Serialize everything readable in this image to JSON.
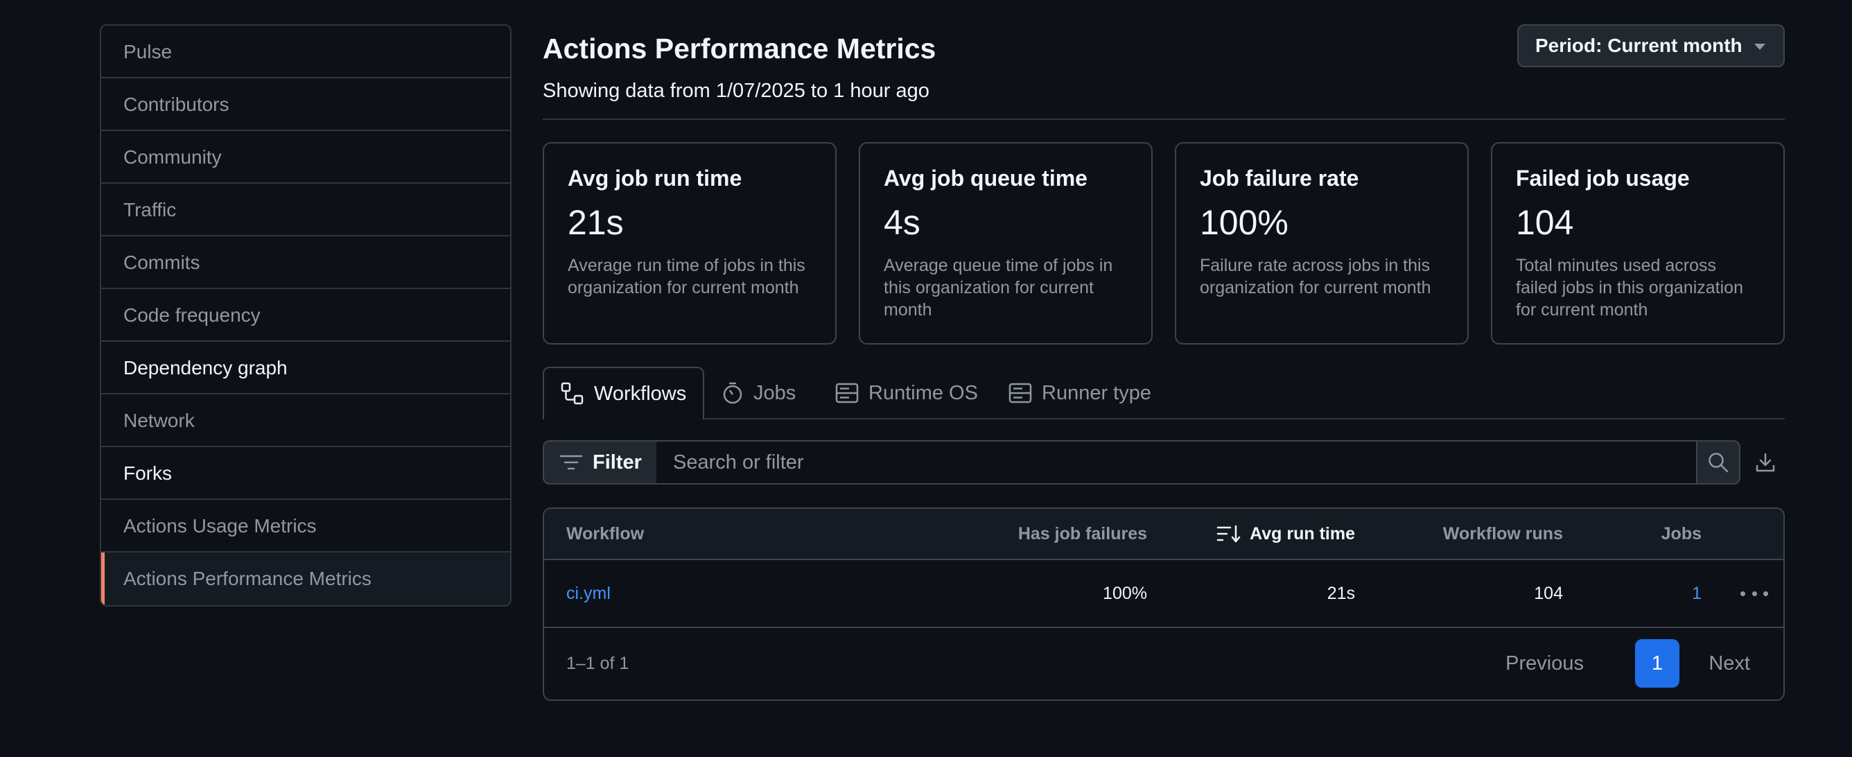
{
  "sidebar": {
    "items": [
      {
        "label": "Pulse"
      },
      {
        "label": "Contributors"
      },
      {
        "label": "Community"
      },
      {
        "label": "Traffic"
      },
      {
        "label": "Commits"
      },
      {
        "label": "Code frequency"
      },
      {
        "label": "Dependency graph"
      },
      {
        "label": "Network"
      },
      {
        "label": "Forks"
      },
      {
        "label": "Actions Usage Metrics"
      },
      {
        "label": "Actions Performance Metrics"
      }
    ]
  },
  "header": {
    "title": "Actions Performance Metrics",
    "subtitle": "Showing data from 1/07/2025 to 1 hour ago",
    "period_label": "Period: Current month"
  },
  "cards": [
    {
      "title": "Avg job run time",
      "value": "21s",
      "description": "Average run time of jobs in this organization for current month"
    },
    {
      "title": "Avg job queue time",
      "value": "4s",
      "description": "Average queue time of jobs in this organization for current month"
    },
    {
      "title": "Job failure rate",
      "value": "100%",
      "description": "Failure rate across jobs in this organization for current month"
    },
    {
      "title": "Failed job usage",
      "value": "104",
      "description": "Total minutes used across failed jobs in this organization for current month"
    }
  ],
  "tabs": [
    {
      "label": "Workflows",
      "icon": "workflow-icon"
    },
    {
      "label": "Jobs",
      "icon": "stopwatch-icon"
    },
    {
      "label": "Runtime OS",
      "icon": "server-icon"
    },
    {
      "label": "Runner type",
      "icon": "server-icon"
    }
  ],
  "filter": {
    "button_label": "Filter",
    "placeholder": "Search or filter"
  },
  "table": {
    "headers": {
      "workflow": "Workflow",
      "has_job_failures": "Has job failures",
      "avg_run_time": "Avg run time",
      "workflow_runs": "Workflow runs",
      "jobs": "Jobs"
    },
    "rows": [
      {
        "workflow": "ci.yml",
        "has_job_failures": "100%",
        "avg_run_time": "21s",
        "workflow_runs": "104",
        "jobs": "1"
      }
    ],
    "count_text": "1–1 of 1"
  },
  "pagination": {
    "previous": "Previous",
    "current_page": "1",
    "next": "Next"
  },
  "colors": {
    "background": "#0d1117",
    "accent": "#1f6feb",
    "link": "#4493f8",
    "selected_marker": "#f78166"
  }
}
